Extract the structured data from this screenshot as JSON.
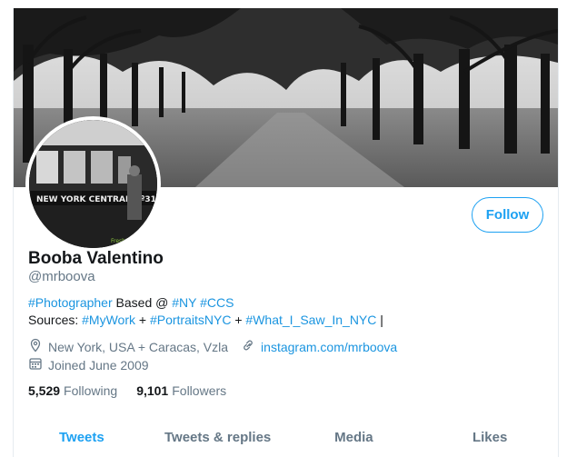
{
  "profile": {
    "name": "Booba Valentino",
    "handle": "@mrboova",
    "follow_label": "Follow",
    "avatar_text": "NEW YORK CENTRAL Nº31"
  },
  "bio": {
    "line1_tag1": "#Photographer",
    "line1_text": " Based @ ",
    "line1_tag2": "#NY",
    "line1_tag3": "#CCS",
    "line2_text": "Sources: ",
    "line2_tag1": "#MyWork",
    "line2_plus1": " + ",
    "line2_tag2": "#PortraitsNYC",
    "line2_plus2": " + ",
    "line2_tag3": "#What_I_Saw_In_NYC",
    "line2_end": " |"
  },
  "meta": {
    "location": "New York, USA + Caracas, Vzla",
    "website": "instagram.com/mrboova",
    "joined": "Joined June 2009"
  },
  "stats": {
    "following_count": "5,529",
    "following_label": "Following",
    "followers_count": "9,101",
    "followers_label": "Followers"
  },
  "tabs": [
    {
      "label": "Tweets",
      "active": true
    },
    {
      "label": "Tweets & replies",
      "active": false
    },
    {
      "label": "Media",
      "active": false
    },
    {
      "label": "Likes",
      "active": false
    }
  ],
  "colors": {
    "accent": "#1da1f2",
    "link": "#1b95e0",
    "muted": "#657786"
  }
}
